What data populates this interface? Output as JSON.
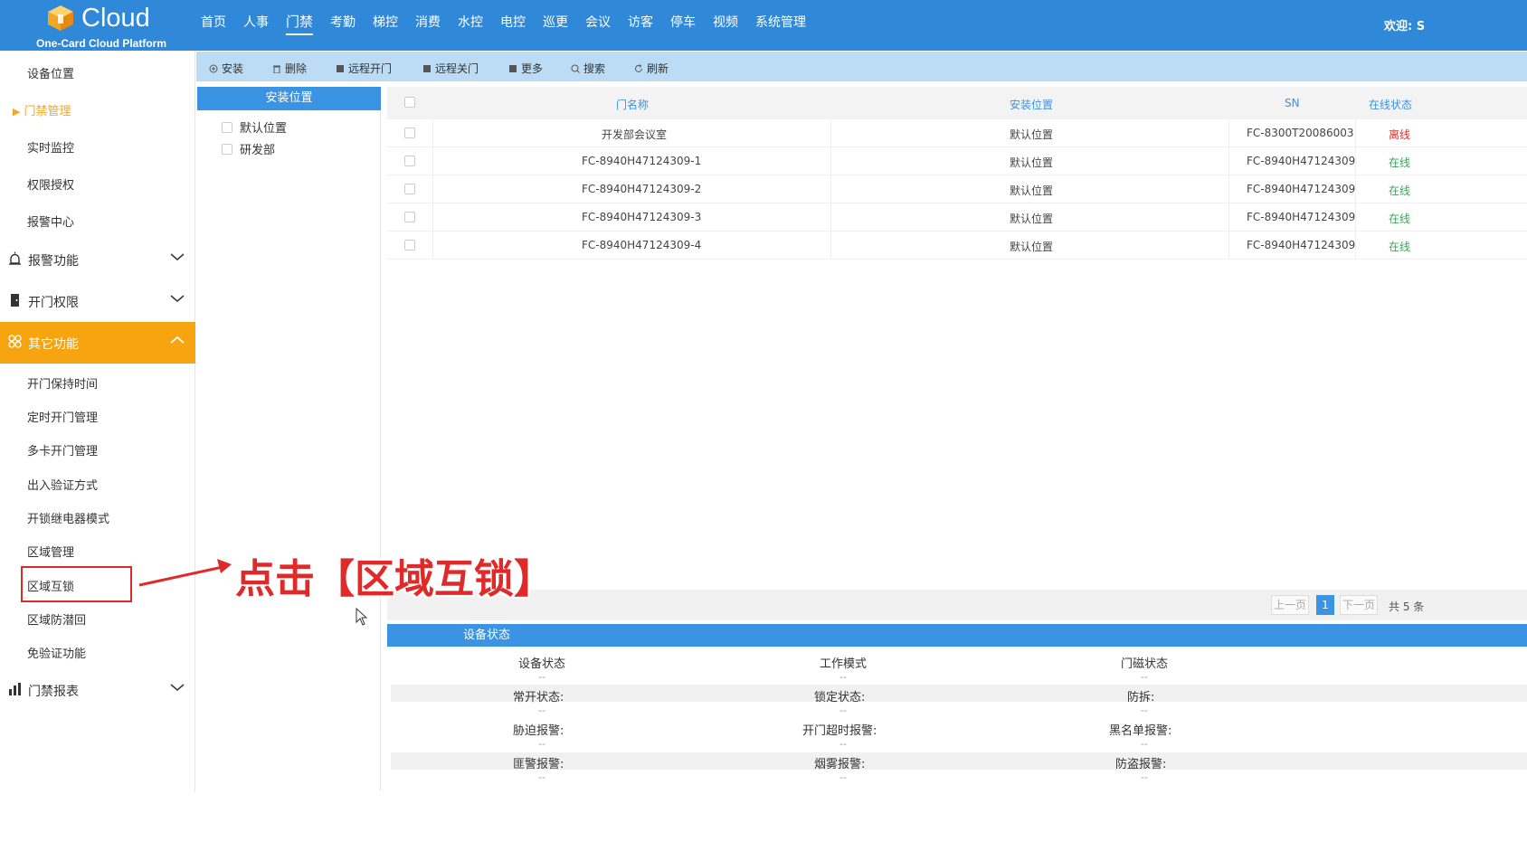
{
  "header": {
    "logo_text": "Cloud",
    "logo_subtitle": "One-Card Cloud Platform",
    "nav": [
      "首页",
      "人事",
      "门禁",
      "考勤",
      "梯控",
      "消费",
      "水控",
      "电控",
      "巡更",
      "会议",
      "访客",
      "停车",
      "视频",
      "系统管理"
    ],
    "active_nav": "门禁",
    "welcome": "欢迎: S"
  },
  "sidebar": {
    "top_items": [
      "设备位置",
      "门禁管理",
      "实时监控",
      "权限授权",
      "报警中心"
    ],
    "current_item": "门禁管理",
    "groups": {
      "alarm": "报警功能",
      "door_permission": "开门权限",
      "other": "其它功能",
      "report": "门禁报表"
    },
    "other_items": [
      "开门保持时间",
      "定时开门管理",
      "多卡开门管理",
      "出入验证方式",
      "开锁继电器模式",
      "区域管理",
      "区域互锁",
      "区域防潜回",
      "免验证功能"
    ]
  },
  "toolbar": {
    "install": "安装",
    "delete": "删除",
    "remote_open": "远程开门",
    "remote_close": "远程关门",
    "more": "更多",
    "search": "搜索",
    "refresh": "刷新"
  },
  "tree": {
    "title": "安装位置",
    "items": [
      "默认位置",
      "研发部"
    ]
  },
  "grid": {
    "columns": [
      "门名称",
      "安装位置",
      "SN",
      "在线状态"
    ],
    "rows": [
      {
        "name": "开发部会议室",
        "location": "默认位置",
        "sn": "FC-8300T20086003",
        "status": "离线"
      },
      {
        "name": "FC-8940H47124309-1",
        "location": "默认位置",
        "sn": "FC-8940H47124309",
        "status": "在线"
      },
      {
        "name": "FC-8940H47124309-2",
        "location": "默认位置",
        "sn": "FC-8940H47124309",
        "status": "在线"
      },
      {
        "name": "FC-8940H47124309-3",
        "location": "默认位置",
        "sn": "FC-8940H47124309",
        "status": "在线"
      },
      {
        "name": "FC-8940H47124309-4",
        "location": "默认位置",
        "sn": "FC-8940H47124309",
        "status": "在线"
      }
    ]
  },
  "pager": {
    "prev": "上一页",
    "page": "1",
    "next": "下一页",
    "total": "共 5 条"
  },
  "device_status": {
    "title": "设备状态",
    "rows": [
      [
        "设备状态",
        "工作模式",
        "门磁状态"
      ],
      [
        "常开状态:",
        "锁定状态:",
        "防拆:"
      ],
      [
        "胁迫报警:",
        "开门超时报警:",
        "黑名单报警:"
      ],
      [
        "匪警报警:",
        "烟雾报警:",
        "防盗报警:"
      ]
    ],
    "empty_value": "--"
  },
  "annotation": {
    "text": "点击【区域互锁】"
  },
  "colors": {
    "header_blue": "#2f88d8",
    "accent_orange": "#f6a40f",
    "online_green": "#3aa35a",
    "offline_red": "#e0312b",
    "annotation_red": "#e02a2a"
  }
}
